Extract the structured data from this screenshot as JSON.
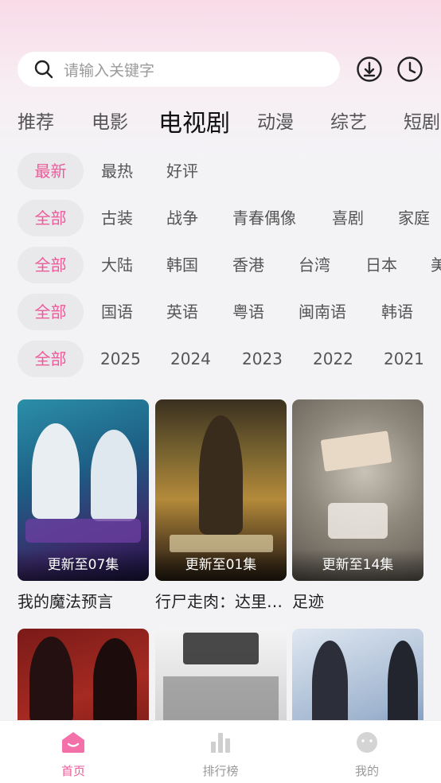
{
  "search": {
    "placeholder": "请输入关键字"
  },
  "header_icons": [
    "download-icon",
    "history-icon"
  ],
  "tabs": [
    {
      "label": "推荐",
      "active": false
    },
    {
      "label": "电影",
      "active": false
    },
    {
      "label": "电视剧",
      "active": true
    },
    {
      "label": "动漫",
      "active": false
    },
    {
      "label": "综艺",
      "active": false
    },
    {
      "label": "短剧",
      "active": false
    }
  ],
  "filters": {
    "sort": [
      "最新",
      "最热",
      "好评"
    ],
    "genre": [
      "全部",
      "古装",
      "战争",
      "青春偶像",
      "喜剧",
      "家庭"
    ],
    "region": [
      "全部",
      "大陆",
      "韩国",
      "香港",
      "台湾",
      "日本",
      "美"
    ],
    "language": [
      "全部",
      "国语",
      "英语",
      "粤语",
      "闽南语",
      "韩语"
    ],
    "year": [
      "全部",
      "2025",
      "2024",
      "2023",
      "2022",
      "2021"
    ]
  },
  "cards": [
    {
      "title": "我的魔法预言",
      "badge": "更新至07集"
    },
    {
      "title": "行尸走肉：达里…",
      "badge": "更新至01集"
    },
    {
      "title": "足迹",
      "badge": "更新至14集"
    },
    {
      "title": "",
      "badge": ""
    },
    {
      "title": "",
      "badge": ""
    },
    {
      "title": "",
      "badge": ""
    }
  ],
  "nav": [
    {
      "label": "首页",
      "icon": "home-icon",
      "active": true
    },
    {
      "label": "排行榜",
      "icon": "ranking-icon",
      "active": false
    },
    {
      "label": "我的",
      "icon": "profile-icon",
      "active": false
    }
  ],
  "colors": {
    "accent": "#ee5a9a",
    "background": "#f3f3f6"
  }
}
